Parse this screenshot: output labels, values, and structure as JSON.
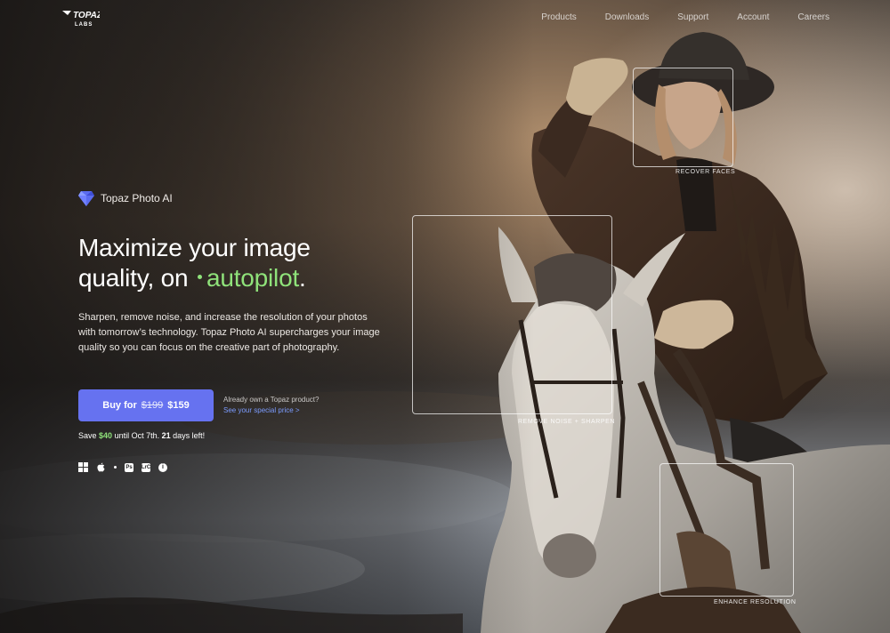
{
  "nav": {
    "logo_text": "TOPAZ LABS",
    "links": [
      "Products",
      "Downloads",
      "Support",
      "Account",
      "Careers"
    ]
  },
  "hero": {
    "product_name": "Topaz Photo AI",
    "headline_line1": "Maximize your image",
    "headline_line2_prefix": "quality, on",
    "headline_accent": "autopilot",
    "headline_suffix": ".",
    "description": "Sharpen, remove noise, and increase the resolution of your photos with tomorrow’s technology. Topaz Photo AI supercharges your image quality so you can focus on the creative part of photography.",
    "buy_label": "Buy for",
    "old_price": "$199",
    "new_price": "$159",
    "owner_question": "Already own a Topaz product?",
    "owner_link": "See your special price >",
    "save_prefix": "Save",
    "save_amount": "$40",
    "save_middle": "until Oct 7th.",
    "days_left": "21",
    "save_suffix": "days left!"
  },
  "platforms": [
    {
      "name": "windows-icon"
    },
    {
      "name": "apple-icon"
    },
    {
      "name": "photoshop-icon",
      "label": "Ps"
    },
    {
      "name": "lightroom-classic-icon",
      "label": "LrC"
    },
    {
      "name": "info-icon",
      "label": "i"
    }
  ],
  "features": [
    {
      "label": "RECOVER FACES"
    },
    {
      "label": "REMOVE NOISE + SHARPEN"
    },
    {
      "label": "ENHANCE RESOLUTION"
    }
  ],
  "colors": {
    "accent_green": "#8fe27a",
    "button_purple": "#6672f0",
    "link_blue": "#7c9cff"
  }
}
